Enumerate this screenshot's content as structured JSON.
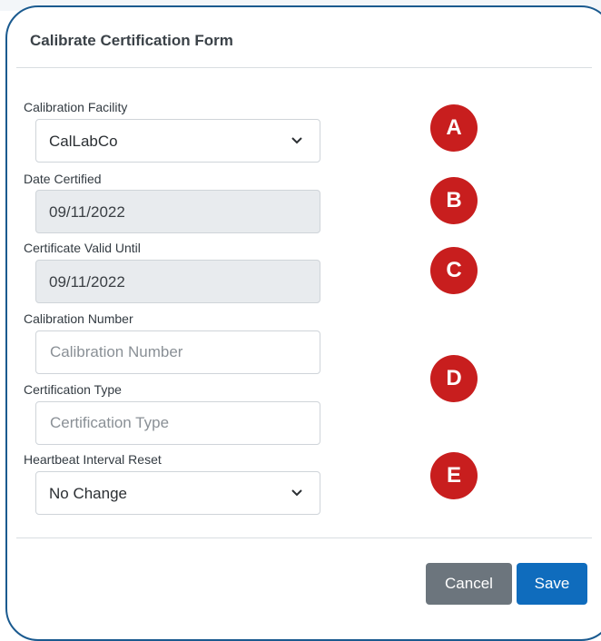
{
  "form": {
    "title": "Calibrate Certification Form",
    "fields": [
      {
        "label": "Calibration Facility",
        "type": "select",
        "value": "CalLabCo",
        "icon": "chevron-down-icon"
      },
      {
        "label": "Date Certified",
        "type": "date-readonly",
        "value": "09/11/2022"
      },
      {
        "label": "Certificate Valid Until",
        "type": "date-readonly",
        "value": "09/11/2022"
      },
      {
        "label": "Calibration Number",
        "type": "text",
        "value": "",
        "placeholder": "Calibration Number"
      },
      {
        "label": "Certification Type",
        "type": "text",
        "value": "",
        "placeholder": "Certification Type"
      },
      {
        "label": "Heartbeat Interval Reset",
        "type": "select",
        "value": "No Change",
        "icon": "chevron-down-icon"
      }
    ]
  },
  "callouts": [
    "A",
    "B",
    "C",
    "D",
    "E"
  ],
  "buttons": {
    "cancel": "Cancel",
    "save": "Save"
  },
  "colors": {
    "frame": "#1a5a8f",
    "callout": "#c81e1e",
    "cancel_button": "#6c757d",
    "save_button": "#0f6cbd",
    "disabled_field": "#e8ebee"
  }
}
